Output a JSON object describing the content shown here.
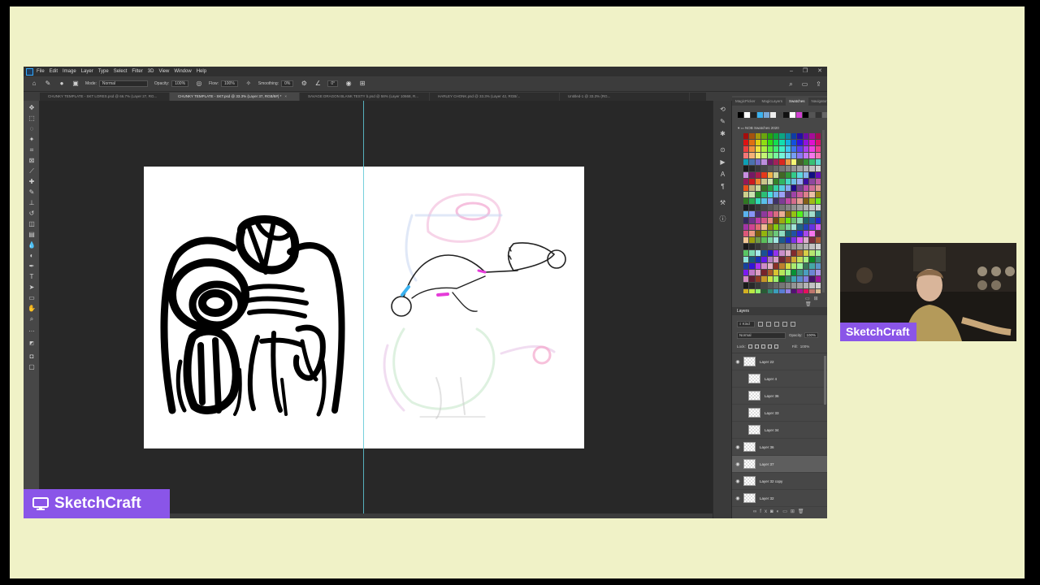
{
  "menu": [
    "File",
    "Edit",
    "Image",
    "Layer",
    "Type",
    "Select",
    "Filter",
    "3D",
    "View",
    "Window",
    "Help"
  ],
  "options": {
    "mode_label": "Mode:",
    "mode_value": "Normal",
    "opacity_label": "Opacity:",
    "opacity_value": "100%",
    "flow_label": "Flow:",
    "flow_value": "100%",
    "smoothing_label": "Smoothing:",
    "smoothing_value": "0%",
    "angle_value": "0°",
    "brush_size": "25"
  },
  "tabs": [
    {
      "label": "CHUNKY TEMPLATE - SKT LORES.psd @ 66.7% (Layer 27, RG..."
    },
    {
      "label": "CHUNKY TEMPLATE - SKT.psd @ 33.3% (Layer 37, RGB/8#) *"
    },
    {
      "label": "SAVAGE DRAGON BLANK TESTY b.psd @ 58% (Layer 10668, R..."
    },
    {
      "label": "HARLEY CHONK.psd @ 33.3% (Layer 42, RGB/..."
    },
    {
      "label": "Untitled-1 @ 33.3% (RG..."
    }
  ],
  "panel": {
    "tabs": [
      "MagicPicker",
      "MagicLayers",
      "Swatches",
      "Navigator"
    ],
    "swatch_folder": "NOB Swatches 2020",
    "layers_title": "Layers",
    "kind_label": "Kind",
    "blend_mode": "Normal",
    "opacity_label": "Opacity:",
    "opacity_value": "100%",
    "lock_label": "Lock:",
    "fill_label": "Fill:",
    "fill_value": "100%"
  },
  "layers": [
    {
      "name": "Layer 22",
      "visible": true
    },
    {
      "name": "Layer 4",
      "visible": false
    },
    {
      "name": "Layer 36",
      "visible": false
    },
    {
      "name": "Layer 33",
      "visible": false
    },
    {
      "name": "Layer 34",
      "visible": false
    },
    {
      "name": "Layer 36",
      "visible": true
    },
    {
      "name": "Layer 37",
      "visible": true,
      "selected": true
    },
    {
      "name": "Layer 32 copy",
      "visible": true
    },
    {
      "name": "Layer 32",
      "visible": true
    }
  ],
  "stream": {
    "webcam_label": "SketchCraft",
    "brand_label": "SketchCraft",
    "accent_color": "#8a55e8",
    "background_color": "#f0f2c7"
  }
}
